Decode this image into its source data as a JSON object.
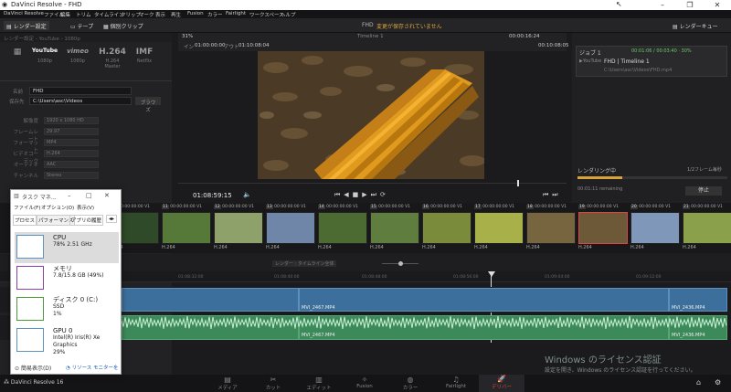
{
  "window": {
    "title": "DaVinci Resolve - FHD"
  },
  "menu": [
    "DaVinci Resolve",
    "ファイル",
    "編集",
    "トリム",
    "タイムライン",
    "クリップ",
    "マーク",
    "表示",
    "再生",
    "Fusion",
    "カラー",
    "Fairlight",
    "ワークスペース",
    "ヘルプ"
  ],
  "toolbar": {
    "render_settings": "レンダー設定",
    "tape": "テープ",
    "clips": "個別クリップ",
    "project_name": "FHD",
    "unsaved": "変更が保存されていません",
    "render_queue": "レンダーキュー"
  },
  "left": {
    "header": "レンダー設定 - YouTube - 1080p",
    "formats": [
      {
        "icon": "YouTube",
        "label": "1080p"
      },
      {
        "icon": "vimeo",
        "label": "1080p"
      },
      {
        "icon": "H.264",
        "label": "H.264 Master"
      },
      {
        "icon": "IMF",
        "label": "Netflix"
      }
    ],
    "name_label": "名前",
    "name_value": "FHD",
    "location_label": "保存先",
    "location_value": "C:\\Users\\asc\\Videos",
    "browse": "ブラウズ",
    "settings": [
      {
        "label": "解像度",
        "value": "1920 x 1080 HD"
      },
      {
        "label": "フレームレート",
        "value": "29.97"
      },
      {
        "label": "フォーマット",
        "value": "MP4"
      },
      {
        "label": "ビデオコーデック",
        "value": "H.264"
      },
      {
        "label": "オーディオ",
        "value": "AAC"
      },
      {
        "label": "チャンネル",
        "value": "Stereo"
      }
    ]
  },
  "viewer": {
    "zoom": "31%",
    "in": "01:00:00:00",
    "out": "01:10:08:04",
    "timeline_name": "Timeline 1",
    "duration": "00:00:16:24",
    "total": "00:10:08:05",
    "timecode": "01:08:59:15"
  },
  "render_queue": {
    "job": "ジョブ 1",
    "job_status": "00:01:06 / 00:03:40 · 30%",
    "job_title": "FHD | Timeline 1",
    "job_path": "C:\\Users\\asc\\Videos\\FHD.mp4",
    "rendering": "レンダリング中",
    "fps": "1/2フレーム毎秒",
    "remaining": "00:01:11 remaining",
    "stop": "停止"
  },
  "clips": [
    {
      "num": "10",
      "tc": "00:00:00:00",
      "track": "V1",
      "codec": "H.264",
      "color": "#2e4a28"
    },
    {
      "num": "11",
      "tc": "00:00:00:00",
      "track": "V1",
      "codec": "H.264",
      "color": "#56793a"
    },
    {
      "num": "12",
      "tc": "00:00:00:00",
      "track": "V1",
      "codec": "H.264",
      "color": "#8fa16a"
    },
    {
      "num": "13",
      "tc": "00:00:00:00",
      "track": "V1",
      "codec": "H.264",
      "color": "#6f86a8"
    },
    {
      "num": "14",
      "tc": "00:00:00:00",
      "track": "V1",
      "codec": "H.264",
      "color": "#4c6b33"
    },
    {
      "num": "15",
      "tc": "00:00:00:00",
      "track": "V1",
      "codec": "H.264",
      "color": "#5e7d3f"
    },
    {
      "num": "16",
      "tc": "00:00:00:00",
      "track": "V1",
      "codec": "H.264",
      "color": "#7a8b3b"
    },
    {
      "num": "17",
      "tc": "00:00:00:00",
      "track": "V1",
      "codec": "H.264",
      "color": "#a8b04a"
    },
    {
      "num": "18",
      "tc": "00:00:00:00",
      "track": "V1",
      "codec": "H.264",
      "color": "#76653f"
    },
    {
      "num": "19",
      "tc": "00:00:00:00",
      "track": "V1",
      "codec": "H.264",
      "color": "#6d5838"
    },
    {
      "num": "20",
      "tc": "00:00:00:00",
      "track": "V1",
      "codec": "H.264",
      "color": "#7f97b8"
    },
    {
      "num": "21",
      "tc": "00:00:00:00",
      "track": "V1",
      "codec": "H.264",
      "color": "#8aa04a"
    }
  ],
  "timeline": {
    "ruler": [
      "01:08:32:00",
      "01:08:40:00",
      "01:08:48:00",
      "01:08:56:00",
      "01:09:04:00",
      "01:09:12:00"
    ],
    "video_clips": [
      "MVI_2467.MP4",
      "MVI_2436.MP4"
    ],
    "audio_clips": [
      "MVI_2467.MP4",
      "MVI_2436.MP4"
    ]
  },
  "task_manager": {
    "title": "タスク マネ...",
    "menu": [
      "ファイル(F)",
      "オプション(O)",
      "表示(V)"
    ],
    "tabs": [
      "プロセス",
      "パフォーマンス",
      "アプリの履歴"
    ],
    "items": [
      {
        "name": "CPU",
        "line1": "78% 2.51 GHz",
        "line2": "",
        "color": "#5b93c5"
      },
      {
        "name": "メモリ",
        "line1": "7.8/15.8 GB (49%)",
        "line2": "",
        "color": "#8b3fa8"
      },
      {
        "name": "ディスク 0 (C:)",
        "line1": "SSD",
        "line2": "1%",
        "color": "#4a9a3a"
      },
      {
        "name": "GPU 0",
        "line1": "Intel(R) Iris(R) Xe Graphics",
        "line2": "29%",
        "color": "#5b93c5"
      }
    ],
    "simple": "簡易表示(D)",
    "monitor": "リソース モニターを"
  },
  "watermark": {
    "line1": "Windows のライセンス認証",
    "line2": "設定を開き、Windows のライセンス認証を行ってください。"
  },
  "pages": [
    "メディア",
    "カット",
    "エディット",
    "Fusion",
    "カラー",
    "Fairlight",
    "デリバー"
  ],
  "app_footer": "DaVinci Resolve 16"
}
